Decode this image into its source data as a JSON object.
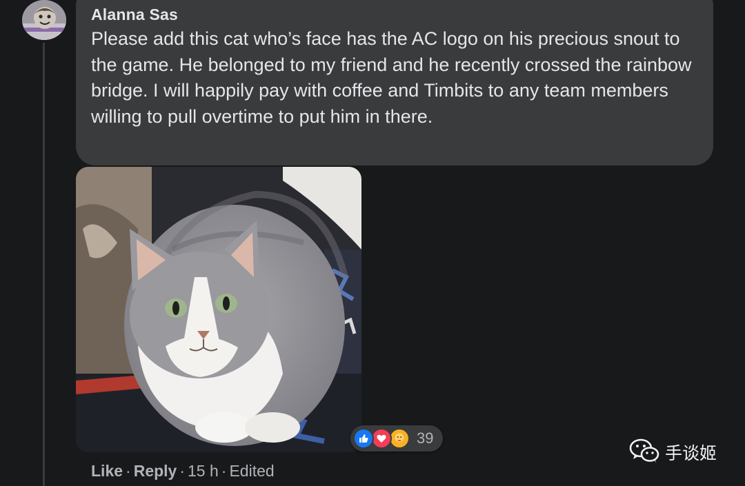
{
  "comment": {
    "author": "Alanna Sas",
    "text": "Please add this cat who’s face has the AC logo on his precious snout to the game. He belonged to my friend and he recently crossed the rainbow bridge. I will happily pay with coffee and Timbits to any team members willing to pull overtime to put him in there.",
    "photo_icon": "cat-photo",
    "reactions": {
      "icons": [
        "like-icon",
        "love-icon",
        "care-icon"
      ],
      "count": "39"
    },
    "actions": {
      "like": "Like",
      "reply": "Reply",
      "time": "15 h",
      "edited": "Edited",
      "separator": "·"
    }
  },
  "watermark": {
    "icon": "wechat-icon",
    "text": "手谈姬"
  },
  "colors": {
    "background": "#18191b",
    "bubble": "#3a3b3c",
    "text": "#e4e6eb",
    "secondary_text": "#b0b3b8",
    "like": "#1877f2",
    "love": "#f33e58",
    "care": "#f7b125"
  }
}
